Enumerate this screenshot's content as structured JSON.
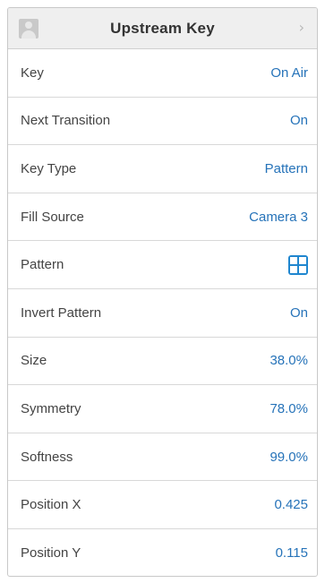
{
  "header": {
    "title": "Upstream Key",
    "avatar_icon": "user-avatar-icon",
    "chevron_icon": "chevron-right-icon"
  },
  "rows": [
    {
      "label": "Key",
      "value": "On Air"
    },
    {
      "label": "Next Transition",
      "value": "On"
    },
    {
      "label": "Key Type",
      "value": "Pattern"
    },
    {
      "label": "Fill Source",
      "value": "Camera 3"
    },
    {
      "label": "Pattern",
      "value_icon": "box-wipe-pattern-icon"
    },
    {
      "label": "Invert Pattern",
      "value": "On"
    },
    {
      "label": "Size",
      "value": "38.0%"
    },
    {
      "label": "Symmetry",
      "value": "78.0%"
    },
    {
      "label": "Softness",
      "value": "99.0%"
    },
    {
      "label": "Position X",
      "value": "0.425"
    },
    {
      "label": "Position Y",
      "value": "0.115"
    }
  ],
  "colors": {
    "value_text": "#2673b9",
    "label_text": "#444444",
    "header_bg": "#efefef",
    "pattern_icon": "#1f86cf"
  }
}
